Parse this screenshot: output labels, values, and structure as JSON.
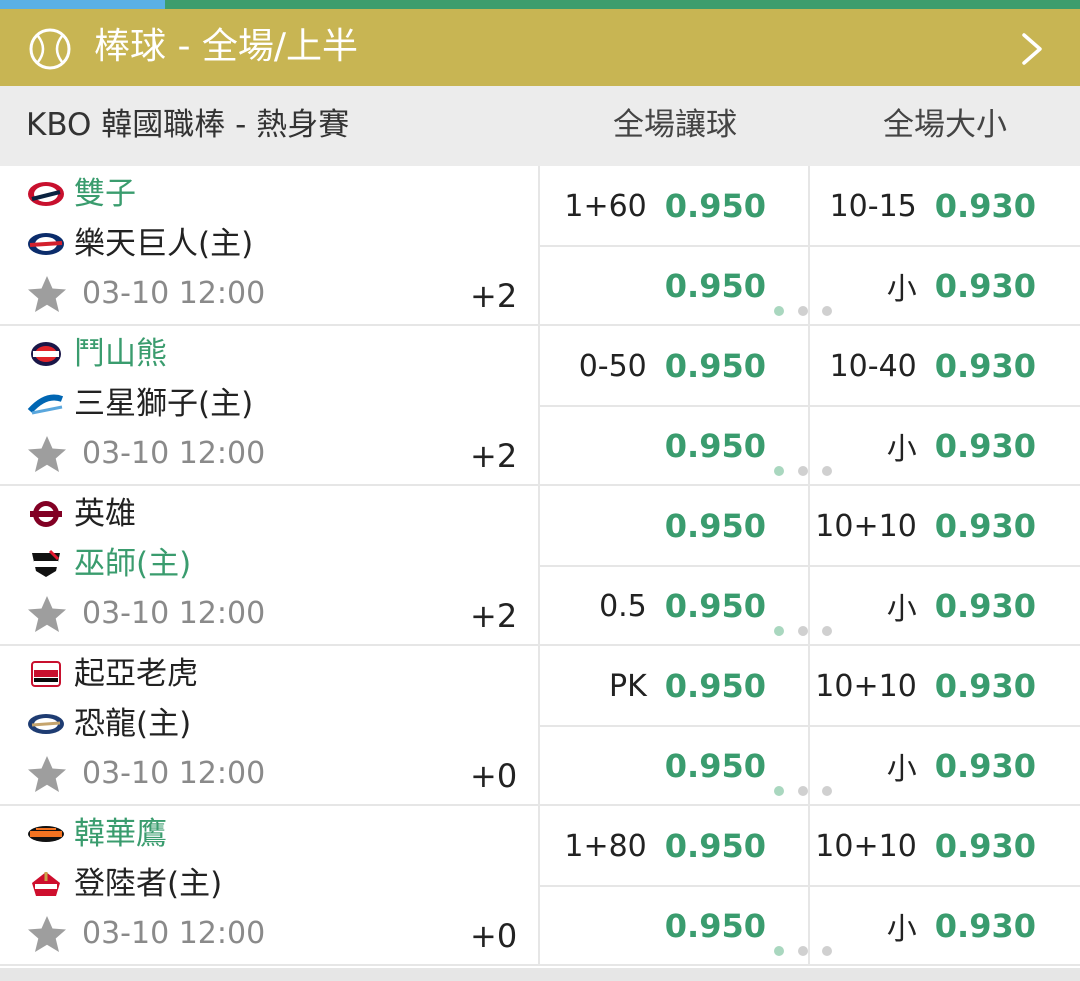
{
  "header": {
    "title": "棒球 - 全場/上半",
    "icon": "baseball-icon",
    "chevron": "chevron-right-icon"
  },
  "columns": {
    "league": "KBO 韓國職棒 - 熱身賽",
    "handicap": "全場讓球",
    "overunder": "全場大小"
  },
  "colors": {
    "header_bg": "#c8b553",
    "accent_green": "#3a9c6e",
    "top_strip": "#3d9d6d"
  },
  "matches": [
    {
      "team1": {
        "name": "雙子",
        "highlight": true,
        "logo": "twins-logo"
      },
      "team2": {
        "name": "樂天巨人(主)",
        "highlight": false,
        "logo": "giants-logo"
      },
      "time": "03-10 12:00",
      "more": "+2",
      "hdp": [
        {
          "line": "1+60",
          "odds": "0.950"
        },
        {
          "line": "",
          "odds": "0.950"
        }
      ],
      "ou": [
        {
          "line": "10-15",
          "odds": "0.930"
        },
        {
          "line": "小",
          "odds": "0.930"
        }
      ]
    },
    {
      "team1": {
        "name": "鬥山熊",
        "highlight": true,
        "logo": "bears-logo"
      },
      "team2": {
        "name": "三星獅子(主)",
        "highlight": false,
        "logo": "lions-logo"
      },
      "time": "03-10 12:00",
      "more": "+2",
      "hdp": [
        {
          "line": "0-50",
          "odds": "0.950"
        },
        {
          "line": "",
          "odds": "0.950"
        }
      ],
      "ou": [
        {
          "line": "10-40",
          "odds": "0.930"
        },
        {
          "line": "小",
          "odds": "0.930"
        }
      ]
    },
    {
      "team1": {
        "name": "英雄",
        "highlight": false,
        "logo": "heroes-logo"
      },
      "team2": {
        "name": "巫師(主)",
        "highlight": true,
        "logo": "wiz-logo"
      },
      "time": "03-10 12:00",
      "more": "+2",
      "hdp": [
        {
          "line": "",
          "odds": "0.950"
        },
        {
          "line": "0.5",
          "odds": "0.950"
        }
      ],
      "ou": [
        {
          "line": "10+10",
          "odds": "0.930"
        },
        {
          "line": "小",
          "odds": "0.930"
        }
      ]
    },
    {
      "team1": {
        "name": "起亞老虎",
        "highlight": false,
        "logo": "tigers-logo"
      },
      "team2": {
        "name": "恐龍(主)",
        "highlight": false,
        "logo": "dinos-logo"
      },
      "time": "03-10 12:00",
      "more": "+0",
      "hdp": [
        {
          "line": "PK",
          "odds": "0.950"
        },
        {
          "line": "",
          "odds": "0.950"
        }
      ],
      "ou": [
        {
          "line": "10+10",
          "odds": "0.930"
        },
        {
          "line": "小",
          "odds": "0.930"
        }
      ]
    },
    {
      "team1": {
        "name": "韓華鷹",
        "highlight": true,
        "logo": "eagles-logo"
      },
      "team2": {
        "name": "登陸者(主)",
        "highlight": false,
        "logo": "landers-logo"
      },
      "time": "03-10 12:00",
      "more": "+0",
      "hdp": [
        {
          "line": "1+80",
          "odds": "0.950"
        },
        {
          "line": "",
          "odds": "0.950"
        }
      ],
      "ou": [
        {
          "line": "10+10",
          "odds": "0.930"
        },
        {
          "line": "小",
          "odds": "0.930"
        }
      ]
    }
  ]
}
